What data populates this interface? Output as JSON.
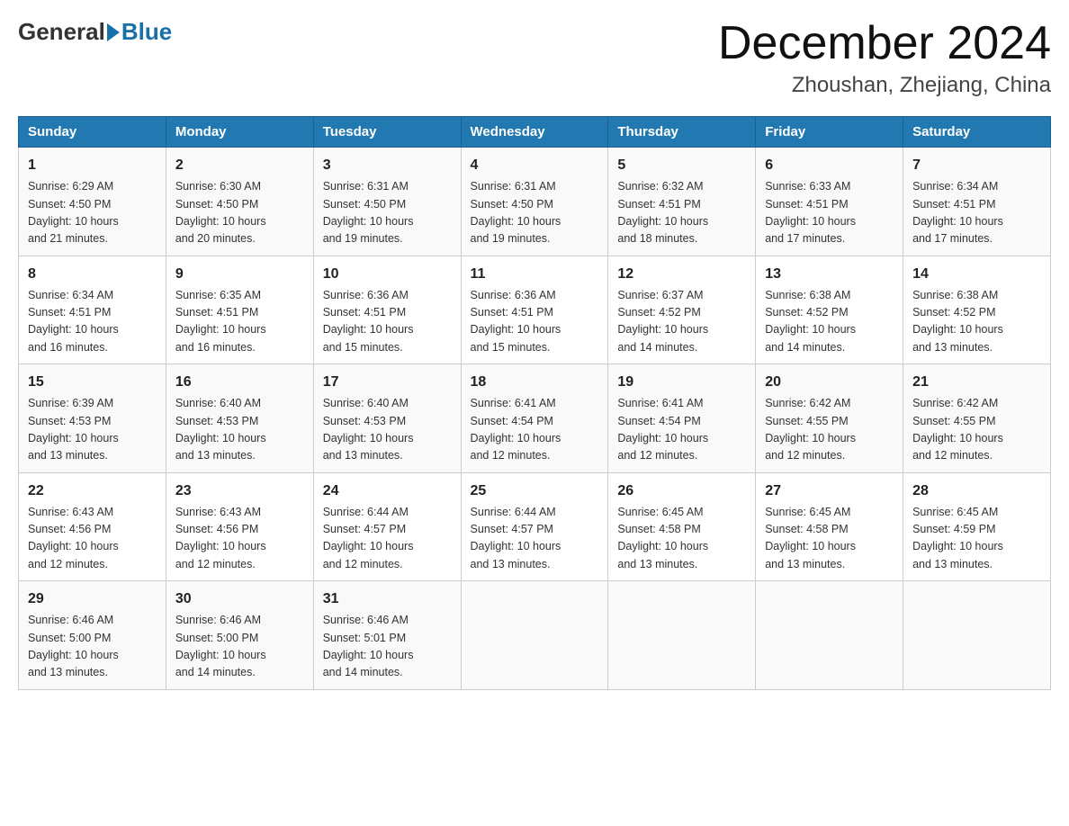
{
  "header": {
    "logo_general": "General",
    "logo_blue": "Blue",
    "month_title": "December 2024",
    "location": "Zhoushan, Zhejiang, China"
  },
  "columns": [
    "Sunday",
    "Monday",
    "Tuesday",
    "Wednesday",
    "Thursday",
    "Friday",
    "Saturday"
  ],
  "weeks": [
    [
      {
        "day": "1",
        "sunrise": "6:29 AM",
        "sunset": "4:50 PM",
        "daylight": "10 hours and 21 minutes."
      },
      {
        "day": "2",
        "sunrise": "6:30 AM",
        "sunset": "4:50 PM",
        "daylight": "10 hours and 20 minutes."
      },
      {
        "day": "3",
        "sunrise": "6:31 AM",
        "sunset": "4:50 PM",
        "daylight": "10 hours and 19 minutes."
      },
      {
        "day": "4",
        "sunrise": "6:31 AM",
        "sunset": "4:50 PM",
        "daylight": "10 hours and 19 minutes."
      },
      {
        "day": "5",
        "sunrise": "6:32 AM",
        "sunset": "4:51 PM",
        "daylight": "10 hours and 18 minutes."
      },
      {
        "day": "6",
        "sunrise": "6:33 AM",
        "sunset": "4:51 PM",
        "daylight": "10 hours and 17 minutes."
      },
      {
        "day": "7",
        "sunrise": "6:34 AM",
        "sunset": "4:51 PM",
        "daylight": "10 hours and 17 minutes."
      }
    ],
    [
      {
        "day": "8",
        "sunrise": "6:34 AM",
        "sunset": "4:51 PM",
        "daylight": "10 hours and 16 minutes."
      },
      {
        "day": "9",
        "sunrise": "6:35 AM",
        "sunset": "4:51 PM",
        "daylight": "10 hours and 16 minutes."
      },
      {
        "day": "10",
        "sunrise": "6:36 AM",
        "sunset": "4:51 PM",
        "daylight": "10 hours and 15 minutes."
      },
      {
        "day": "11",
        "sunrise": "6:36 AM",
        "sunset": "4:51 PM",
        "daylight": "10 hours and 15 minutes."
      },
      {
        "day": "12",
        "sunrise": "6:37 AM",
        "sunset": "4:52 PM",
        "daylight": "10 hours and 14 minutes."
      },
      {
        "day": "13",
        "sunrise": "6:38 AM",
        "sunset": "4:52 PM",
        "daylight": "10 hours and 14 minutes."
      },
      {
        "day": "14",
        "sunrise": "6:38 AM",
        "sunset": "4:52 PM",
        "daylight": "10 hours and 13 minutes."
      }
    ],
    [
      {
        "day": "15",
        "sunrise": "6:39 AM",
        "sunset": "4:53 PM",
        "daylight": "10 hours and 13 minutes."
      },
      {
        "day": "16",
        "sunrise": "6:40 AM",
        "sunset": "4:53 PM",
        "daylight": "10 hours and 13 minutes."
      },
      {
        "day": "17",
        "sunrise": "6:40 AM",
        "sunset": "4:53 PM",
        "daylight": "10 hours and 13 minutes."
      },
      {
        "day": "18",
        "sunrise": "6:41 AM",
        "sunset": "4:54 PM",
        "daylight": "10 hours and 12 minutes."
      },
      {
        "day": "19",
        "sunrise": "6:41 AM",
        "sunset": "4:54 PM",
        "daylight": "10 hours and 12 minutes."
      },
      {
        "day": "20",
        "sunrise": "6:42 AM",
        "sunset": "4:55 PM",
        "daylight": "10 hours and 12 minutes."
      },
      {
        "day": "21",
        "sunrise": "6:42 AM",
        "sunset": "4:55 PM",
        "daylight": "10 hours and 12 minutes."
      }
    ],
    [
      {
        "day": "22",
        "sunrise": "6:43 AM",
        "sunset": "4:56 PM",
        "daylight": "10 hours and 12 minutes."
      },
      {
        "day": "23",
        "sunrise": "6:43 AM",
        "sunset": "4:56 PM",
        "daylight": "10 hours and 12 minutes."
      },
      {
        "day": "24",
        "sunrise": "6:44 AM",
        "sunset": "4:57 PM",
        "daylight": "10 hours and 12 minutes."
      },
      {
        "day": "25",
        "sunrise": "6:44 AM",
        "sunset": "4:57 PM",
        "daylight": "10 hours and 13 minutes."
      },
      {
        "day": "26",
        "sunrise": "6:45 AM",
        "sunset": "4:58 PM",
        "daylight": "10 hours and 13 minutes."
      },
      {
        "day": "27",
        "sunrise": "6:45 AM",
        "sunset": "4:58 PM",
        "daylight": "10 hours and 13 minutes."
      },
      {
        "day": "28",
        "sunrise": "6:45 AM",
        "sunset": "4:59 PM",
        "daylight": "10 hours and 13 minutes."
      }
    ],
    [
      {
        "day": "29",
        "sunrise": "6:46 AM",
        "sunset": "5:00 PM",
        "daylight": "10 hours and 13 minutes."
      },
      {
        "day": "30",
        "sunrise": "6:46 AM",
        "sunset": "5:00 PM",
        "daylight": "10 hours and 14 minutes."
      },
      {
        "day": "31",
        "sunrise": "6:46 AM",
        "sunset": "5:01 PM",
        "daylight": "10 hours and 14 minutes."
      },
      null,
      null,
      null,
      null
    ]
  ],
  "labels": {
    "sunrise": "Sunrise:",
    "sunset": "Sunset:",
    "daylight": "Daylight:"
  }
}
